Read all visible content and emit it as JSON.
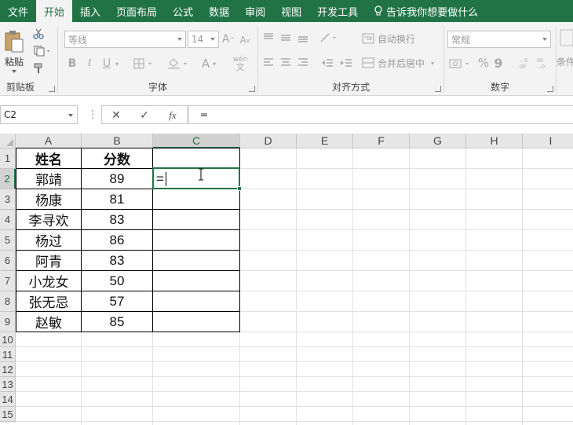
{
  "tabs": [
    {
      "label": "文件",
      "active": false
    },
    {
      "label": "开始",
      "active": true
    },
    {
      "label": "插入",
      "active": false
    },
    {
      "label": "页面布局",
      "active": false
    },
    {
      "label": "公式",
      "active": false
    },
    {
      "label": "数据",
      "active": false
    },
    {
      "label": "审阅",
      "active": false
    },
    {
      "label": "视图",
      "active": false
    },
    {
      "label": "开发工具",
      "active": false
    }
  ],
  "tell_me": "告诉我你想要做什么",
  "ribbon": {
    "clipboard": {
      "label": "剪贴板",
      "paste_label": "粘贴"
    },
    "font": {
      "label": "字体",
      "font_name": "等线",
      "font_size": "14",
      "bold": "B",
      "italic": "I",
      "underline": "U",
      "grow": "A",
      "shrink": "A",
      "font_color": "A",
      "phonetic": "wén",
      "phonetic_sub": "文"
    },
    "alignment": {
      "label": "对齐方式",
      "wrap_text": "自动换行",
      "merge_center": "合并后居中"
    },
    "number": {
      "label": "数字",
      "format": "常规",
      "percent": "%",
      "comma": "9"
    },
    "styles": {
      "conditional": "条件"
    }
  },
  "formula_bar": {
    "name_box": "C2",
    "cancel": "✕",
    "enter": "✓",
    "fx": "fx",
    "content": "="
  },
  "columns": [
    "A",
    "B",
    "C",
    "D",
    "E",
    "F",
    "G",
    "H",
    "I"
  ],
  "rows": [
    "1",
    "2",
    "3",
    "4",
    "5",
    "6",
    "7",
    "8",
    "9",
    "10",
    "11",
    "12",
    "13",
    "14",
    "15"
  ],
  "table": {
    "headers": [
      "姓名",
      "分数"
    ],
    "rows": [
      [
        "郭靖",
        "89"
      ],
      [
        "杨康",
        "81"
      ],
      [
        "李寻欢",
        "83"
      ],
      [
        "杨过",
        "86"
      ],
      [
        "阿青",
        "83"
      ],
      [
        "小龙女",
        "50"
      ],
      [
        "张无忌",
        "57"
      ],
      [
        "赵敏",
        "85"
      ]
    ]
  },
  "editing_cell": {
    "ref": "C2",
    "text": "="
  },
  "colors": {
    "accent": "#217346",
    "ribbon_bg": "#f3f3f3",
    "header_bg": "#e6e6e6"
  }
}
